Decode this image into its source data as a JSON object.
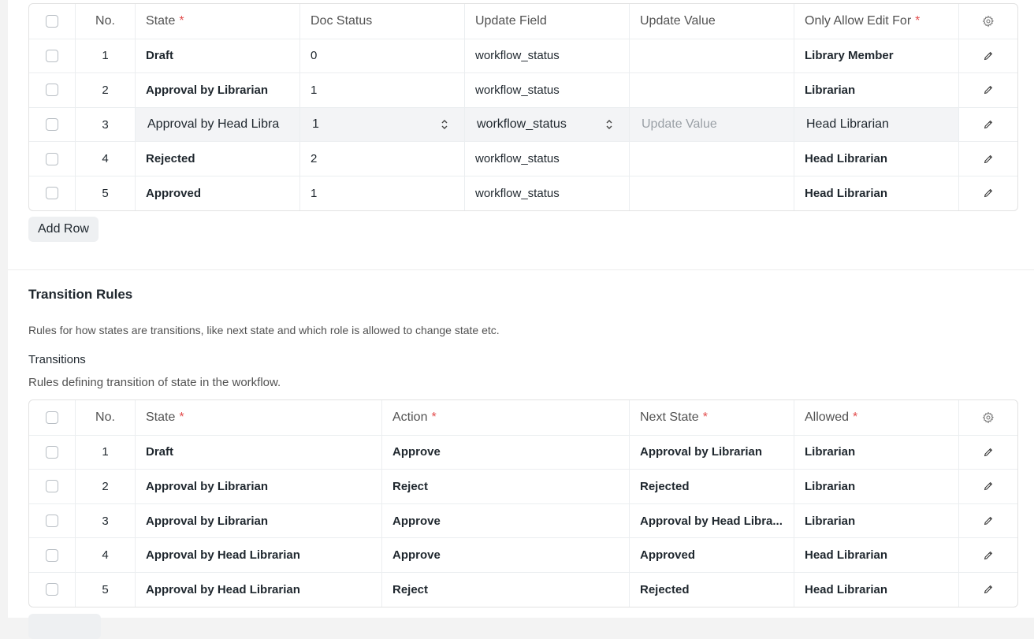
{
  "states_table": {
    "columns": {
      "no": "No.",
      "state": "State",
      "doc_status": "Doc Status",
      "update_field": "Update Field",
      "update_value": "Update Value",
      "only_allow_edit_for": "Only Allow Edit For"
    },
    "required_marker": "*",
    "rows": [
      {
        "no": "1",
        "state": "Draft",
        "doc_status": "0",
        "update_field": "workflow_status",
        "update_value": "",
        "only_allow_edit_for": "Library Member"
      },
      {
        "no": "2",
        "state": "Approval by Librarian",
        "doc_status": "1",
        "update_field": "workflow_status",
        "update_value": "",
        "only_allow_edit_for": "Librarian"
      },
      {
        "no": "3",
        "state": "Approval by Head Libra",
        "doc_status": "1",
        "update_field": "workflow_status",
        "update_value_placeholder": "Update Value",
        "only_allow_edit_for": "Head Librarian"
      },
      {
        "no": "4",
        "state": "Rejected",
        "doc_status": "2",
        "update_field": "workflow_status",
        "update_value": "",
        "only_allow_edit_for": "Head Librarian"
      },
      {
        "no": "5",
        "state": "Approved",
        "doc_status": "1",
        "update_field": "workflow_status",
        "update_value": "",
        "only_allow_edit_for": "Head Librarian"
      }
    ],
    "add_row_label": "Add Row"
  },
  "transition_section": {
    "title": "Transition Rules",
    "description": "Rules for how states are transitions, like next state and which role is allowed to change state etc.",
    "field_label": "Transitions",
    "field_description": "Rules defining transition of state in the workflow."
  },
  "transitions_table": {
    "columns": {
      "no": "No.",
      "state": "State",
      "action": "Action",
      "next_state": "Next State",
      "allowed": "Allowed"
    },
    "required_marker": "*",
    "rows": [
      {
        "no": "1",
        "state": "Draft",
        "action": "Approve",
        "next_state": "Approval by Librarian",
        "allowed": "Librarian"
      },
      {
        "no": "2",
        "state": "Approval by Librarian",
        "action": "Reject",
        "next_state": "Rejected",
        "allowed": "Librarian"
      },
      {
        "no": "3",
        "state": "Approval by Librarian",
        "action": "Approve",
        "next_state": "Approval by Head Libra...",
        "allowed": "Librarian"
      },
      {
        "no": "4",
        "state": "Approval by Head Librarian",
        "action": "Approve",
        "next_state": "Approved",
        "allowed": "Head Librarian"
      },
      {
        "no": "5",
        "state": "Approval by Head Librarian",
        "action": "Reject",
        "next_state": "Rejected",
        "allowed": "Head Librarian"
      }
    ]
  },
  "icons": {
    "settings": "gear-icon",
    "edit": "pencil-icon",
    "select_arrows": "chevron-updown-icon"
  },
  "colors": {
    "required": "#e24c4c",
    "border": "#e2e2e2",
    "button_bg": "#eef0f2"
  }
}
